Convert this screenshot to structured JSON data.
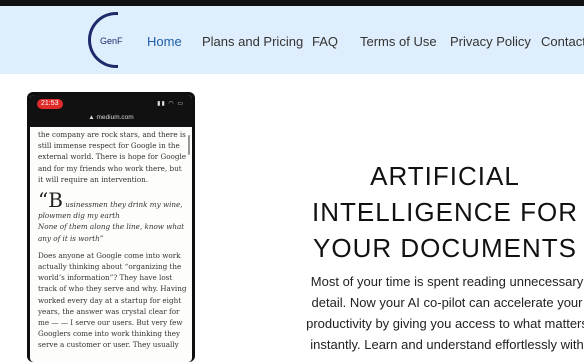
{
  "logo": {
    "text": "GenF"
  },
  "nav": [
    {
      "label": "Home"
    },
    {
      "label": "Plans and Pricing"
    },
    {
      "label": "FAQ"
    },
    {
      "label": "Terms of Use"
    },
    {
      "label": "Privacy Policy"
    },
    {
      "label": "Contact"
    }
  ],
  "phone": {
    "time": "21:53",
    "url": "▲ medium.com",
    "article": {
      "p1": "the company are rock stars, and there is still immense respect for Google in the external world. There is hope for Google and for my friends who work there, but it will require an intervention.",
      "quote_mark": "“B",
      "quote_rest": "usinessmen they drink my wine, plowmen dig my earth",
      "quote_line2": "None of them along the line, know what any of it is worth”",
      "p2": "Does anyone at Google come into work actually thinking about “organizing the world’s information”? They have lost track of who they serve and why. Having worked every day at a startup for eight years, the answer was crystal clear for me — — I serve our users. But very few Googlers come into work thinking they serve a customer or user. They usually"
    }
  },
  "hero": {
    "headline": "ARTIFICIAL INTELLIGENCE FOR YOUR DOCUMENTS",
    "subtext": "Most of your time is spent reading unnecessary detail. Now your AI co-pilot can accelerate your productivity by giving you access to what matters instantly. Learn and understand effortlessly with"
  }
}
